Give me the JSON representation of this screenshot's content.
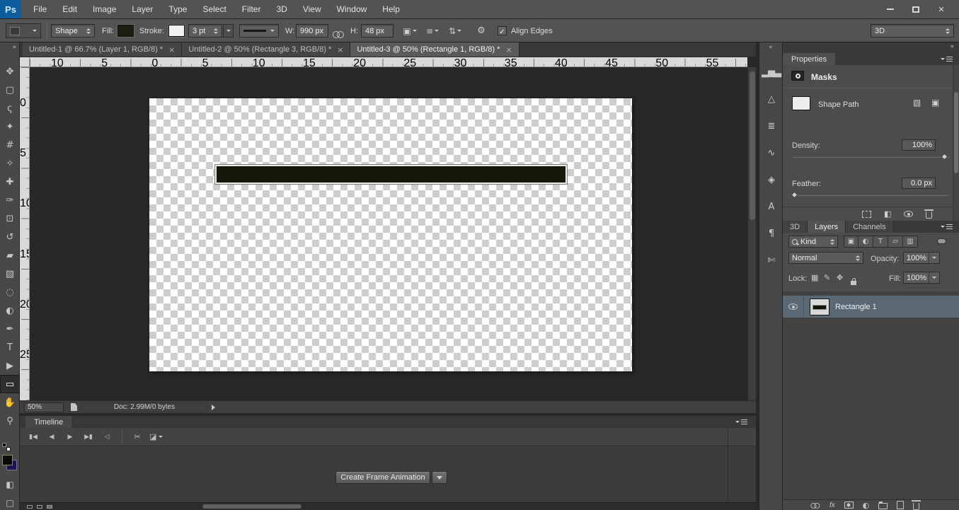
{
  "colors": {
    "logo_bg": "#0d5d9d",
    "shape_fill": "#17170a",
    "shape_stroke": "#ededed",
    "selected_layer_bg": "#5a6874"
  },
  "menu_bar": {
    "logo": "Ps",
    "items": [
      "File",
      "Edit",
      "Image",
      "Layer",
      "Type",
      "Select",
      "Filter",
      "3D",
      "View",
      "Window",
      "Help"
    ]
  },
  "options_bar": {
    "tool_mode": "Shape",
    "fill_label": "Fill:",
    "stroke_label": "Stroke:",
    "stroke_width": "3 pt",
    "width_label": "W:",
    "width_value": "990 px",
    "height_label": "H:",
    "height_value": "48 px",
    "align_edges_label": "Align Edges",
    "workspace": "3D"
  },
  "document_tabs": [
    {
      "label": "Untitled-1 @ 66.7% (Layer 1, RGB/8) *",
      "close": "×",
      "active": false
    },
    {
      "label": "Untitled-2 @ 50% (Rectangle 3, RGB/8) *",
      "close": "×",
      "active": false
    },
    {
      "label": "Untitled-3 @ 50% (Rectangle 1, RGB/8) *",
      "close": "×",
      "active": true
    }
  ],
  "rulers": {
    "top_numbers": [
      "10",
      "5",
      "0",
      "5",
      "10",
      "15",
      "20",
      "25",
      "30",
      "35",
      "40",
      "45",
      "50",
      "55"
    ],
    "left_numbers": [
      "0",
      "5",
      "10",
      "15",
      "20",
      "25"
    ]
  },
  "toolbar": {
    "tools": [
      {
        "name": "move-tool",
        "glyph": "✥"
      },
      {
        "name": "rectangular-marquee-tool",
        "glyph": "▢"
      },
      {
        "name": "lasso-tool",
        "glyph": "ς"
      },
      {
        "name": "quick-selection-tool",
        "glyph": "✦"
      },
      {
        "name": "crop-tool",
        "glyph": "#"
      },
      {
        "name": "eyedropper-tool",
        "glyph": "✧"
      },
      {
        "name": "spot-healing-brush-tool",
        "glyph": "✚"
      },
      {
        "name": "brush-tool",
        "glyph": "✑"
      },
      {
        "name": "clone-stamp-tool",
        "glyph": "⊡"
      },
      {
        "name": "history-brush-tool",
        "glyph": "↺"
      },
      {
        "name": "eraser-tool",
        "glyph": "▰"
      },
      {
        "name": "gradient-tool",
        "glyph": "▧"
      },
      {
        "name": "blur-tool",
        "glyph": "◌"
      },
      {
        "name": "dodge-tool",
        "glyph": "◐"
      },
      {
        "name": "pen-tool",
        "glyph": "✒"
      },
      {
        "name": "horizontal-type-tool",
        "glyph": "T"
      },
      {
        "name": "path-selection-tool",
        "glyph": "▶"
      },
      {
        "name": "rectangle-tool",
        "glyph": "▭",
        "selected": true
      },
      {
        "name": "hand-tool",
        "glyph": "✋"
      },
      {
        "name": "zoom-tool",
        "glyph": "⚲"
      }
    ]
  },
  "panel_strip": {
    "icons": [
      {
        "name": "histogram-panel-icon",
        "glyph": "▂▅▃"
      },
      {
        "name": "navigator-panel-icon",
        "glyph": "△"
      },
      {
        "name": "adjustments-panel-icon",
        "glyph": "≣"
      },
      {
        "name": "curves-panel-icon",
        "glyph": "∿"
      },
      {
        "name": "styles-panel-icon",
        "glyph": "◈"
      },
      {
        "name": "character-panel-icon",
        "glyph": "A"
      },
      {
        "name": "paragraph-panel-icon",
        "glyph": "¶"
      },
      {
        "name": "clone-source-panel-icon",
        "glyph": "✄"
      }
    ]
  },
  "status_bar": {
    "zoom": "50%",
    "doc_info": "Doc: 2.99M/0 bytes"
  },
  "timeline": {
    "tab_label": "Timeline",
    "playback": [
      {
        "name": "go-to-first-frame-button",
        "glyph": "▮◀"
      },
      {
        "name": "previous-frame-button",
        "glyph": "◀"
      },
      {
        "name": "play-button",
        "glyph": "▶"
      },
      {
        "name": "next-frame-button",
        "glyph": "▶▮"
      },
      {
        "name": "mute-audio-button",
        "glyph": "◁"
      }
    ],
    "scissors_icon": "✂",
    "transition_icon": "◪",
    "create_button_label": "Create Frame Animation"
  },
  "properties_panel": {
    "tab_label": "Properties",
    "masks_label": "Masks",
    "shape_path_label": "Shape Path",
    "density_label": "Density:",
    "density_value": "100%",
    "feather_label": "Feather:",
    "feather_value": "0.0 px"
  },
  "layers_panel": {
    "tabs": {
      "threed": "3D",
      "layers": "Layers",
      "channels": "Channels"
    },
    "kind_label": "Kind",
    "filter_buttons": [
      {
        "name": "filter-pixel-layers-button",
        "glyph": "▣"
      },
      {
        "name": "filter-adjustment-layers-button",
        "glyph": "◐"
      },
      {
        "name": "filter-type-layers-button",
        "glyph": "T"
      },
      {
        "name": "filter-shape-layers-button",
        "glyph": "▱"
      },
      {
        "name": "filter-smart-objects-button",
        "glyph": "▥"
      }
    ],
    "blend_mode": "Normal",
    "opacity_label": "Opacity:",
    "opacity_value": "100%",
    "lock_label": "Lock:",
    "fill_label": "Fill:",
    "fill_value": "100%",
    "layers": [
      {
        "name": "Rectangle 1"
      }
    ],
    "fx_label": "fx"
  },
  "icons": {
    "close_window": "✕",
    "collapse_toolbar": "»",
    "expand_dock": "«",
    "collapse_dock": "»",
    "quick_mask": "◧",
    "screen_mode": "□",
    "gear": "⚙",
    "check": "✓",
    "path_operations": "▣",
    "path_alignment": "≡",
    "path_arrangement": "⇅",
    "shape_path_op_a": "▧",
    "shape_path_op_b": "▣",
    "invert_mask_icon": "◧",
    "adjustment": "◐",
    "lock_transparency": "▦",
    "lock_paint": "✎",
    "lock_position": "✥"
  }
}
